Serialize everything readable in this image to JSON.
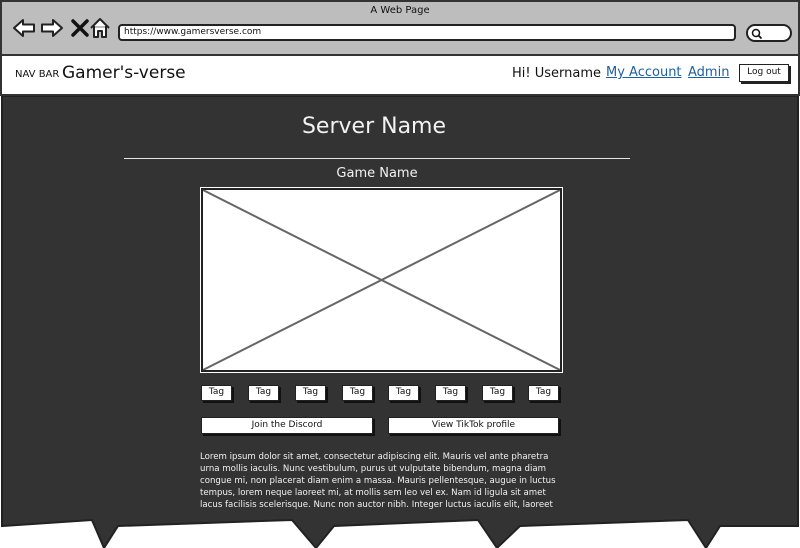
{
  "browser": {
    "window_title": "A Web Page",
    "url": "https://www.gamersverse.com",
    "icons": [
      "back-arrow-icon",
      "forward-arrow-icon",
      "close-icon",
      "home-icon",
      "search-icon"
    ]
  },
  "navbar": {
    "label": "NAV BAR",
    "brand": "Gamer's-verse",
    "greeting": "Hi! Username",
    "my_account": "My Account",
    "admin": "Admin",
    "logout": "Log out"
  },
  "main": {
    "server_name": "Server Name",
    "game_name": "Game Name",
    "tags": [
      "Tag",
      "Tag",
      "Tag",
      "Tag",
      "Tag",
      "Tag",
      "Tag",
      "Tag"
    ],
    "join_discord": "Join the Discord",
    "view_tiktok": "View TikTok profile",
    "description_lines": [
      "Lorem ipsum dolor sit amet, consectetur adipiscing elit. Mauris vel ante pharetra",
      "urna mollis iaculis. Nunc vestibulum, purus ut vulputate bibendum, magna diam",
      "congue mi, non placerat diam enim a massa. Mauris pellentesque, augue in luctus",
      "tempus, lorem neque laoreet mi, at mollis sem leo vel ex. Nam id ligula sit amet",
      "lacus facilisis scelerisque. Nunc non auctor nibh. Integer luctus iaculis elit, laoreet"
    ]
  },
  "colors": {
    "content_bg": "#333333",
    "chrome_bg": "#bdbdbd",
    "link": "#1f5fa0"
  }
}
